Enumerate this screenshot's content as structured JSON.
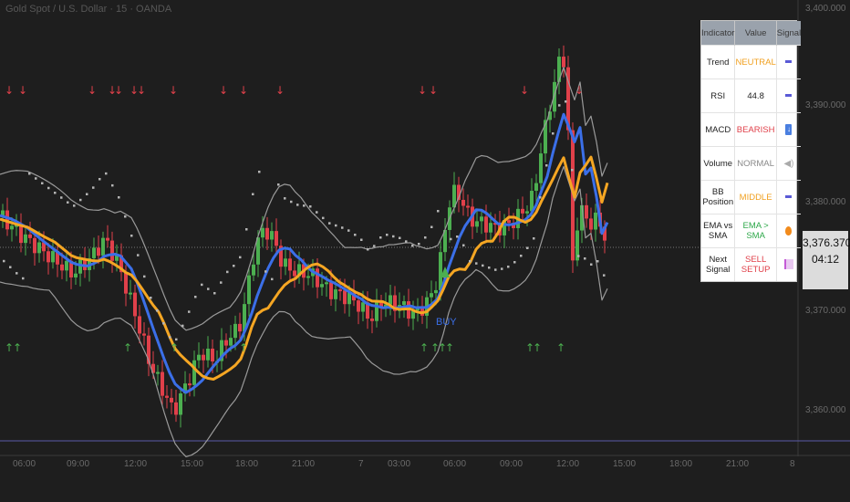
{
  "title": "Gold Spot / U.S. Dollar · 15 · OANDA",
  "price_badge": {
    "price": "3,376.370",
    "countdown": "04:12"
  },
  "y_axis": [
    "3,400.000",
    "3,390.000",
    "3,380.000",
    "3,370.000",
    "3,360.000"
  ],
  "x_axis": [
    "06:00",
    "09:00",
    "12:00",
    "15:00",
    "18:00",
    "21:00",
    "7",
    "03:00",
    "06:00",
    "09:00",
    "12:00",
    "15:00",
    "18:00",
    "21:00",
    "8"
  ],
  "buy_label": "BUY",
  "panel": {
    "headers": [
      "Indicator",
      "Value",
      "Signal"
    ],
    "rows": [
      {
        "indicator": "Trend",
        "value": "NEUTRAL",
        "color": "#f0a020",
        "signal": "dash"
      },
      {
        "indicator": "RSI",
        "value": "44.8",
        "color": "#222222",
        "signal": "dash"
      },
      {
        "indicator": "MACD",
        "value": "BEARISH",
        "color": "#e0404a",
        "signal": "arrow"
      },
      {
        "indicator": "Volume",
        "value": "NORMAL",
        "color": "#888888",
        "signal": "speaker"
      },
      {
        "indicator": "BB Position",
        "value": "MIDDLE",
        "color": "#f0a020",
        "signal": "dash"
      },
      {
        "indicator": "EMA vs SMA",
        "value": "EMA > SMA",
        "color": "#2ea84a",
        "signal": "fire"
      },
      {
        "indicator": "Next Signal",
        "value": "SELL SETUP",
        "color": "#e0404a",
        "signal": "chart"
      }
    ]
  },
  "colors": {
    "up": "#4caf50",
    "down": "#e0404a",
    "ema": "#3b6fe8",
    "sma": "#f5a623",
    "bb": "#9a9a9a",
    "dots": "#b5b5b5",
    "hline": "#5a5aa8"
  }
}
